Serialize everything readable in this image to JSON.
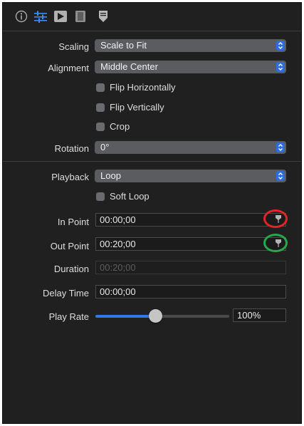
{
  "toolbar": {
    "icons": [
      "info-icon",
      "sliders-icon",
      "play-icon",
      "film-icon",
      "marker-icon"
    ],
    "active_color": "#3d8df5"
  },
  "rows": {
    "scaling": {
      "label": "Scaling",
      "value": "Scale to Fit"
    },
    "alignment": {
      "label": "Alignment",
      "value": "Middle Center"
    },
    "flip_h": {
      "label": "Flip Horizontally",
      "checked": false
    },
    "flip_v": {
      "label": "Flip Vertically",
      "checked": false
    },
    "crop": {
      "label": "Crop",
      "checked": false
    },
    "rotation": {
      "label": "Rotation",
      "value": "0°"
    },
    "playback": {
      "label": "Playback",
      "value": "Loop"
    },
    "soft_loop": {
      "label": "Soft Loop",
      "checked": false
    },
    "in_point": {
      "label": "In Point",
      "value": "00:00;00"
    },
    "out_point": {
      "label": "Out Point",
      "value": "00:20;00"
    },
    "duration": {
      "label": "Duration",
      "value": "00:20;00"
    },
    "delay_time": {
      "label": "Delay Time",
      "value": "00:00;00"
    },
    "play_rate": {
      "label": "Play Rate",
      "value": "100%",
      "slider_fraction": 0.4
    }
  },
  "annotations": {
    "in_point_circle_color": "#e0262b",
    "out_point_circle_color": "#27a84a"
  }
}
